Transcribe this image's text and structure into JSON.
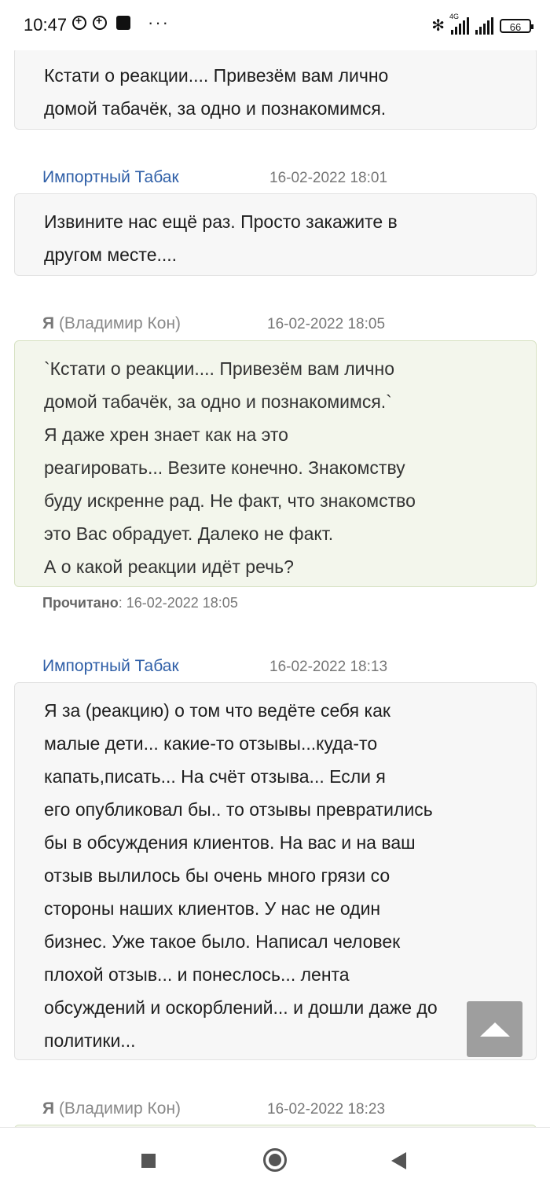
{
  "status_bar": {
    "time": "10:47",
    "network_tag": "4G",
    "battery": "66"
  },
  "messages": [
    {
      "lines": [
        "Кстати о реакции.... Привезём вам лично",
        "домой табачёк, за одно и познакомимся."
      ]
    },
    {
      "author": "Импортный Табак",
      "timestamp": "16-02-2022 18:01",
      "lines": [
        "Извините нас ещё раз. Просто закажите в",
        "другом месте...."
      ]
    },
    {
      "author_prefix": "Я",
      "author": "(Владимир Кон)",
      "timestamp": "16-02-2022 18:05",
      "lines": [
        "`Кстати о реакции.... Привезём вам лично",
        "домой табачёк, за одно и познакомимся.`",
        "Я даже хрен знает как на это",
        "реагировать... Везите конечно. Знакомству",
        "буду искренне рад. Не факт, что знакомство",
        "это Вас обрадует. Далеко не факт.",
        "А о какой реакции идёт речь?"
      ],
      "read_label": "Прочитано",
      "read_time": ": 16-02-2022 18:05"
    },
    {
      "author": "Импортный Табак",
      "timestamp": "16-02-2022 18:13",
      "lines": [
        "Я за (реакцию) о том что ведёте себя как",
        "малые дети... какие-то отзывы...куда-то",
        "капать,писать... На счёт отзыва... Если я",
        "его опубликовал бы.. то отзывы превратились",
        "бы в обсуждения клиентов. На вас и на ваш",
        "отзыв вылилось бы очень много грязи со",
        "стороны наших клиентов. У нас не один",
        "бизнес. Уже такое было. Написал человек",
        "плохой отзыв... и понеслось... лента",
        "обсуждений и оскорблений... и дошли даже до",
        "политики..."
      ]
    },
    {
      "author_prefix": "Я",
      "author": "(Владимир Кон)",
      "timestamp": "16-02-2022 18:23"
    }
  ],
  "icons": {
    "scroll_top": "arrow-up-icon",
    "nav_recent": "square-icon",
    "nav_home": "circle-icon",
    "nav_back": "triangle-back-icon"
  }
}
